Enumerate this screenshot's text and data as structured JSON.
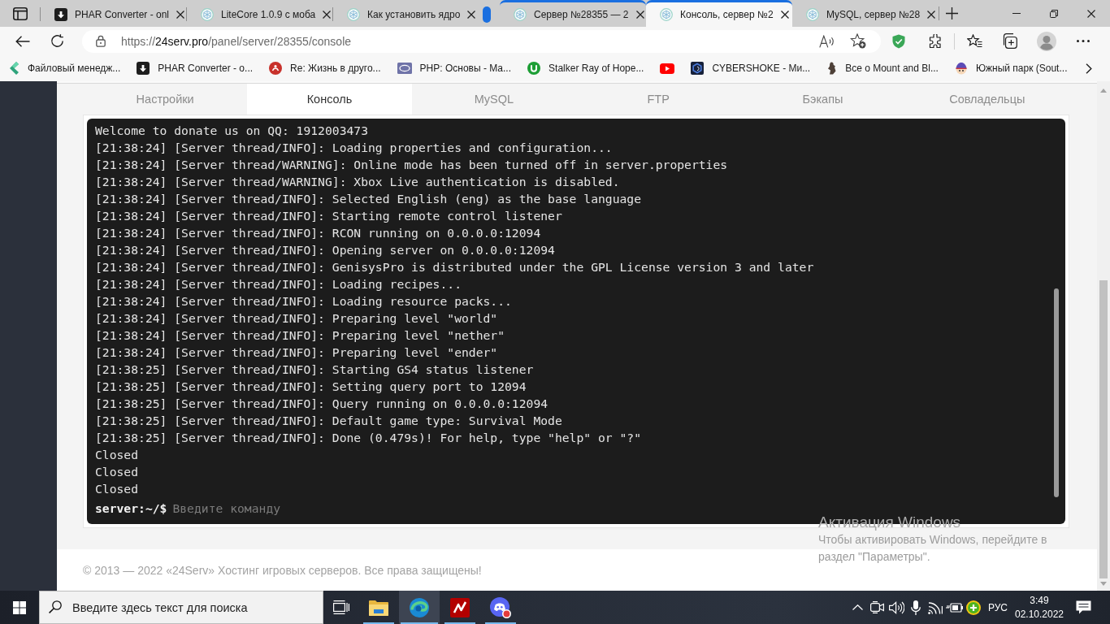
{
  "browser": {
    "tabs": [
      {
        "title": "PHAR Converter - onl",
        "kind": "download",
        "selected": false,
        "grouped": false
      },
      {
        "title": "LiteCore 1.0.9 с моба",
        "kind": "hexagon",
        "selected": false,
        "grouped": false
      },
      {
        "title": "Как установить ядро",
        "kind": "hexagon",
        "selected": false,
        "grouped": false
      },
      {
        "title": "Сервер №28355 — 2",
        "kind": "hexagon",
        "selected": false,
        "grouped": true
      },
      {
        "title": "Консоль, сервер №2",
        "kind": "hexagon",
        "selected": true,
        "grouped": true
      },
      {
        "title": "MySQL, сервер №28",
        "kind": "hexagon",
        "selected": false,
        "grouped": false
      }
    ],
    "address_bar": {
      "url": {
        "scheme": "https://",
        "host": "24serv.pro",
        "path": "/panel/server/28355/console"
      }
    },
    "bookmarks": [
      {
        "label": "Файловый менедж...",
        "kind": "arrow"
      },
      {
        "label": "PHAR Converter - о...",
        "kind": "download"
      },
      {
        "label": "Re: Жизнь в друго...",
        "kind": "seal"
      },
      {
        "label": "PHP: Основы - Ма...",
        "kind": "php"
      },
      {
        "label": "Stalker Ray of Hope...",
        "kind": "ring"
      },
      {
        "kind": "play"
      },
      {
        "label": "CYBERSHOKE - Ми...",
        "kind": "shield"
      },
      {
        "label": "Все о Mount and Bl...",
        "kind": "figure"
      },
      {
        "label": "Южный парк (Sout...",
        "kind": "face"
      }
    ]
  },
  "page": {
    "tabs": [
      {
        "label": "Настройки",
        "selected": false
      },
      {
        "label": "Консоль",
        "selected": true
      },
      {
        "label": "MySQL",
        "selected": false
      },
      {
        "label": "FTP",
        "selected": false
      },
      {
        "label": "Бэкапы",
        "selected": false
      },
      {
        "label": "Совладельцы",
        "selected": false
      }
    ],
    "console": {
      "lines": [
        "Welcome to donate us on QQ: 1912003473",
        "[21:38:24] [Server thread/INFO]: Loading properties and configuration...",
        "[21:38:24] [Server thread/WARNING]: Online mode has been turned off in server.properties",
        "[21:38:24] [Server thread/WARNING]: Xbox Live authentication is disabled.",
        "[21:38:24] [Server thread/INFO]: Selected English (eng) as the base language",
        "[21:38:24] [Server thread/INFO]: Starting remote control listener",
        "[21:38:24] [Server thread/INFO]: RCON running on 0.0.0.0:12094",
        "[21:38:24] [Server thread/INFO]: Opening server on 0.0.0.0:12094",
        "[21:38:24] [Server thread/INFO]: GenisysPro is distributed under the GPL License version 3 and later",
        "[21:38:24] [Server thread/INFO]: Loading recipes...",
        "[21:38:24] [Server thread/INFO]: Loading resource packs...",
        "[21:38:24] [Server thread/INFO]: Preparing level \"world\"",
        "[21:38:24] [Server thread/INFO]: Preparing level \"nether\"",
        "[21:38:24] [Server thread/INFO]: Preparing level \"ender\"",
        "[21:38:25] [Server thread/INFO]: Starting GS4 status listener",
        "[21:38:25] [Server thread/INFO]: Setting query port to 12094",
        "[21:38:25] [Server thread/INFO]: Query running on 0.0.0.0:12094",
        "[21:38:25] [Server thread/INFO]: Default game type: Survival Mode",
        "[21:38:25] [Server thread/INFO]: Done (0.479s)! For help, type \"help\" or \"?\"",
        "Closed",
        "Closed",
        "Closed"
      ],
      "prompt": "server:~/$",
      "placeholder": "Введите команду"
    },
    "footer": "© 2013 — 2022 «24Serv» Хостинг игровых серверов. Все права защищены!"
  },
  "activation_notice": {
    "title": "Активация Windows",
    "text": "Чтобы активировать Windows, перейдите в раздел \"Параметры\"."
  },
  "taskbar": {
    "search": {
      "placeholder": "Введите здесь текст для поиска"
    },
    "apps": [
      {
        "kind": "folder",
        "running": true,
        "selected": false
      },
      {
        "kind": "edge",
        "running": true,
        "selected": true
      },
      {
        "kind": "filezilla",
        "running": true,
        "selected": false
      },
      {
        "kind": "discord",
        "running": true,
        "selected": false
      }
    ],
    "tray": {
      "language": "РУС",
      "time": "3:49",
      "date": "02.10.2022"
    }
  }
}
